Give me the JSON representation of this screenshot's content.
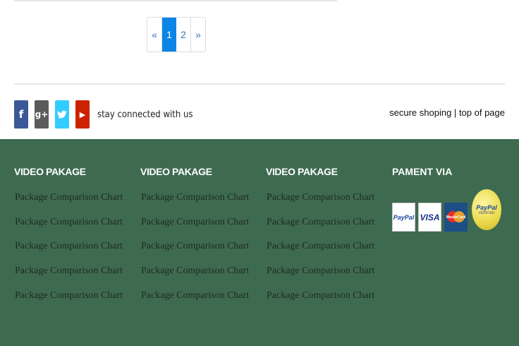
{
  "pagination": {
    "prev": "«",
    "pages": [
      "1",
      "2"
    ],
    "next": "»"
  },
  "social": {
    "icons": [
      "facebook-icon",
      "google-plus-icon",
      "twitter-icon",
      "youtube-icon"
    ],
    "glyphs": [
      "f",
      "g+",
      "",
      "▶"
    ],
    "text": "stay connected with us"
  },
  "top_links": {
    "secure": "secure shoping",
    "separator": "|",
    "top": "top of page"
  },
  "footer": {
    "columns": [
      {
        "heading": "VIDEO PAKAGE",
        "links": [
          "Package Comparison Chart",
          "Package Comparison Chart",
          "Package Comparison Chart",
          "Package Comparison Chart",
          "Package Comparison Chart"
        ]
      },
      {
        "heading": "VIDEO PAKAGE",
        "links": [
          "Package Comparison Chart",
          "Package Comparison Chart",
          "Package Comparison Chart",
          "Package Comparison Chart",
          "Package Comparison Chart"
        ]
      },
      {
        "heading": "VIDEO PAKAGE",
        "links": [
          "Package Comparison Chart",
          "Package Comparison Chart",
          "Package Comparison Chart",
          "Package Comparison Chart",
          "Package Comparison Chart"
        ]
      }
    ],
    "payment": {
      "heading": "PAMENT VIA",
      "cards": [
        "PayPal",
        "VISA",
        "MasterCard"
      ],
      "seal": [
        "PayPal",
        "VERIFIED"
      ]
    },
    "bg_color": "#3e6b50"
  }
}
